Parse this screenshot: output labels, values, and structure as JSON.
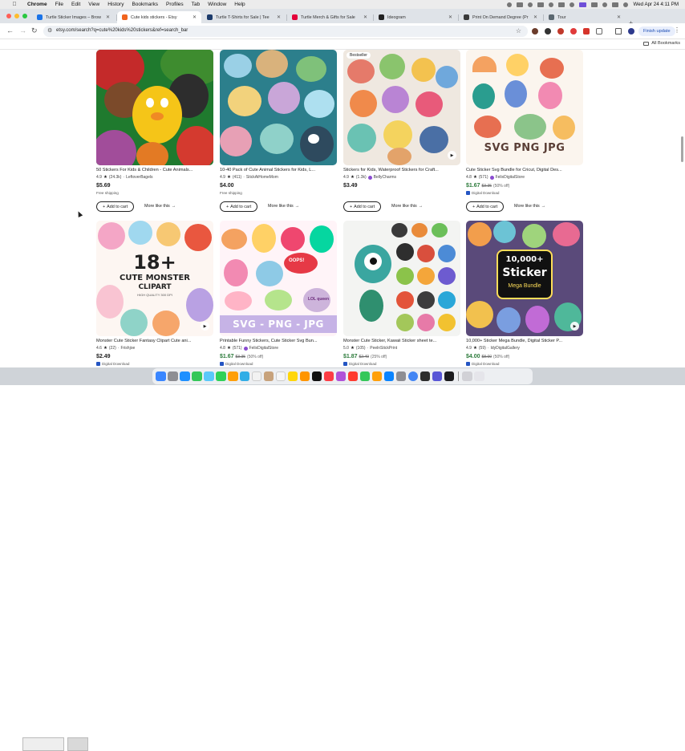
{
  "menubar": {
    "items": [
      "Chrome",
      "File",
      "Edit",
      "View",
      "History",
      "Bookmarks",
      "Profiles",
      "Tab",
      "Window",
      "Help"
    ],
    "datetime": "Wed Apr 24  4:11 PM"
  },
  "tabs": [
    {
      "label": "Turtle Sticker Images – Brow",
      "active": false,
      "favicon_color": "#1a73e8"
    },
    {
      "label": "Cute kids stickers - Etsy",
      "active": true,
      "favicon_color": "#f1641e"
    },
    {
      "label": "Turtle T-Shirts for Sale | Tee",
      "active": false,
      "favicon_color": "#1b3a6b"
    },
    {
      "label": "Turtle Merch & Gifts for Sale",
      "active": false,
      "favicon_color": "#e4003a"
    },
    {
      "label": "Ideogram",
      "active": false,
      "favicon_color": "#222222"
    },
    {
      "label": "Print On Demand Degree (Pr",
      "active": false,
      "favicon_color": "#3a3a3a"
    },
    {
      "label": "Tour",
      "active": false,
      "favicon_color": "#5b6770"
    }
  ],
  "address_bar": {
    "url": "etsy.com/search?q=cute%20kids%20stickers&ref=search_bar",
    "finish_update": "Finish update"
  },
  "bookmarks": {
    "all_bookmarks": "All Bookmarks"
  },
  "listings": [
    {
      "title": "50 Stickers For Kids & Children - Cute Animals...",
      "rating": "4.9",
      "reviews": "(24.3k)",
      "shop": "LeftoverBagels",
      "star_seller": false,
      "price": "$5.69",
      "original_price": "",
      "discount": "",
      "note": "Free shipping",
      "badge": "",
      "video": false,
      "add_to_cart": "Add to cart",
      "more_like_this": "More like this"
    },
    {
      "title": "10-40 Pack of Cute Animal Stickers for Kids, L...",
      "rating": "4.9",
      "reviews": "(411)",
      "shop": "StickAtHomeMom",
      "star_seller": false,
      "price": "$4.00",
      "original_price": "",
      "discount": "",
      "note": "Free shipping",
      "badge": "",
      "video": false,
      "add_to_cart": "Add to cart",
      "more_like_this": "More like this"
    },
    {
      "title": "Stickers for Kids, Waterproof Stickers for Craft...",
      "rating": "4.9",
      "reviews": "(1.3k)",
      "shop": "BellyCharms",
      "star_seller": true,
      "price": "$3.49",
      "original_price": "",
      "discount": "",
      "note": "",
      "badge": "Bestseller",
      "video": true,
      "add_to_cart": "Add to cart",
      "more_like_this": "More like this"
    },
    {
      "title": "Cute Sticker Svg Bundle for Cricut, Digital Des...",
      "rating": "4.8",
      "reviews": "(571)",
      "shop": "FelixDigitalStore",
      "star_seller": true,
      "price": "$1.67",
      "original_price": "$3.35",
      "discount": "(50% off)",
      "note": "Digital Download",
      "badge": "",
      "video": false,
      "add_to_cart": "Add to cart",
      "more_like_this": "More like this"
    },
    {
      "title": "Monster Cute Sticker Fantasy Clipart Cute ani...",
      "rating": "4.6",
      "reviews": "(22)",
      "shop": "Frishjoe",
      "star_seller": false,
      "price": "$2.49",
      "original_price": "",
      "discount": "",
      "note": "Digital Download",
      "badge": "",
      "video": true,
      "art_text": [
        "18+",
        "CUTE MONSTER",
        "CLIPART",
        "HIGH QUALITY 300 DPI"
      ],
      "add_to_cart": "Add to cart",
      "more_like_this": "More like this"
    },
    {
      "title": "Printable Funny Stickers, Cute Sticker Svg Bun...",
      "rating": "4.8",
      "reviews": "(571)",
      "shop": "FelixDigitalStore",
      "star_seller": true,
      "price": "$1.67",
      "original_price": "$3.35",
      "discount": "(50% off)",
      "note": "Digital Download",
      "badge": "",
      "video": false,
      "art_text": [
        "SVG - PNG - JPG",
        "OOPS!",
        "LOL queen"
      ],
      "add_to_cart": "Add to cart",
      "more_like_this": "More like this"
    },
    {
      "title": "Monster Cute Sticker, Kawaii Sticker sheet te...",
      "rating": "5.0",
      "reviews": "(105)",
      "shop": "PeelnStickPrint",
      "star_seller": false,
      "price": "$1.87",
      "original_price": "$2.49",
      "discount": "(25% off)",
      "note": "Digital Download",
      "badge": "",
      "video": false,
      "add_to_cart": "Add to cart",
      "more_like_this": "More like this"
    },
    {
      "title": "10,000+ Sticker Mega Bundle, Digital Sticker P...",
      "rating": "4.9",
      "reviews": "(59)",
      "shop": "IdyDigitalGallery",
      "star_seller": false,
      "price": "$4.00",
      "original_price": "$8.00",
      "discount": "(50% off)",
      "note": "Digital Download",
      "badge": "",
      "video": true,
      "art_text": [
        "10,000+",
        "Sticker",
        "Mega Bundle"
      ],
      "add_to_cart": "Add to cart",
      "more_like_this": "More like this"
    }
  ],
  "svg_bundle_text": "SVG PNG JPG",
  "colors": {
    "etsy_orange": "#f1641e",
    "sale_green": "#2b7a3a",
    "star_seller_purple": "#8a4cd0",
    "digital_blue": "#2455c3"
  }
}
